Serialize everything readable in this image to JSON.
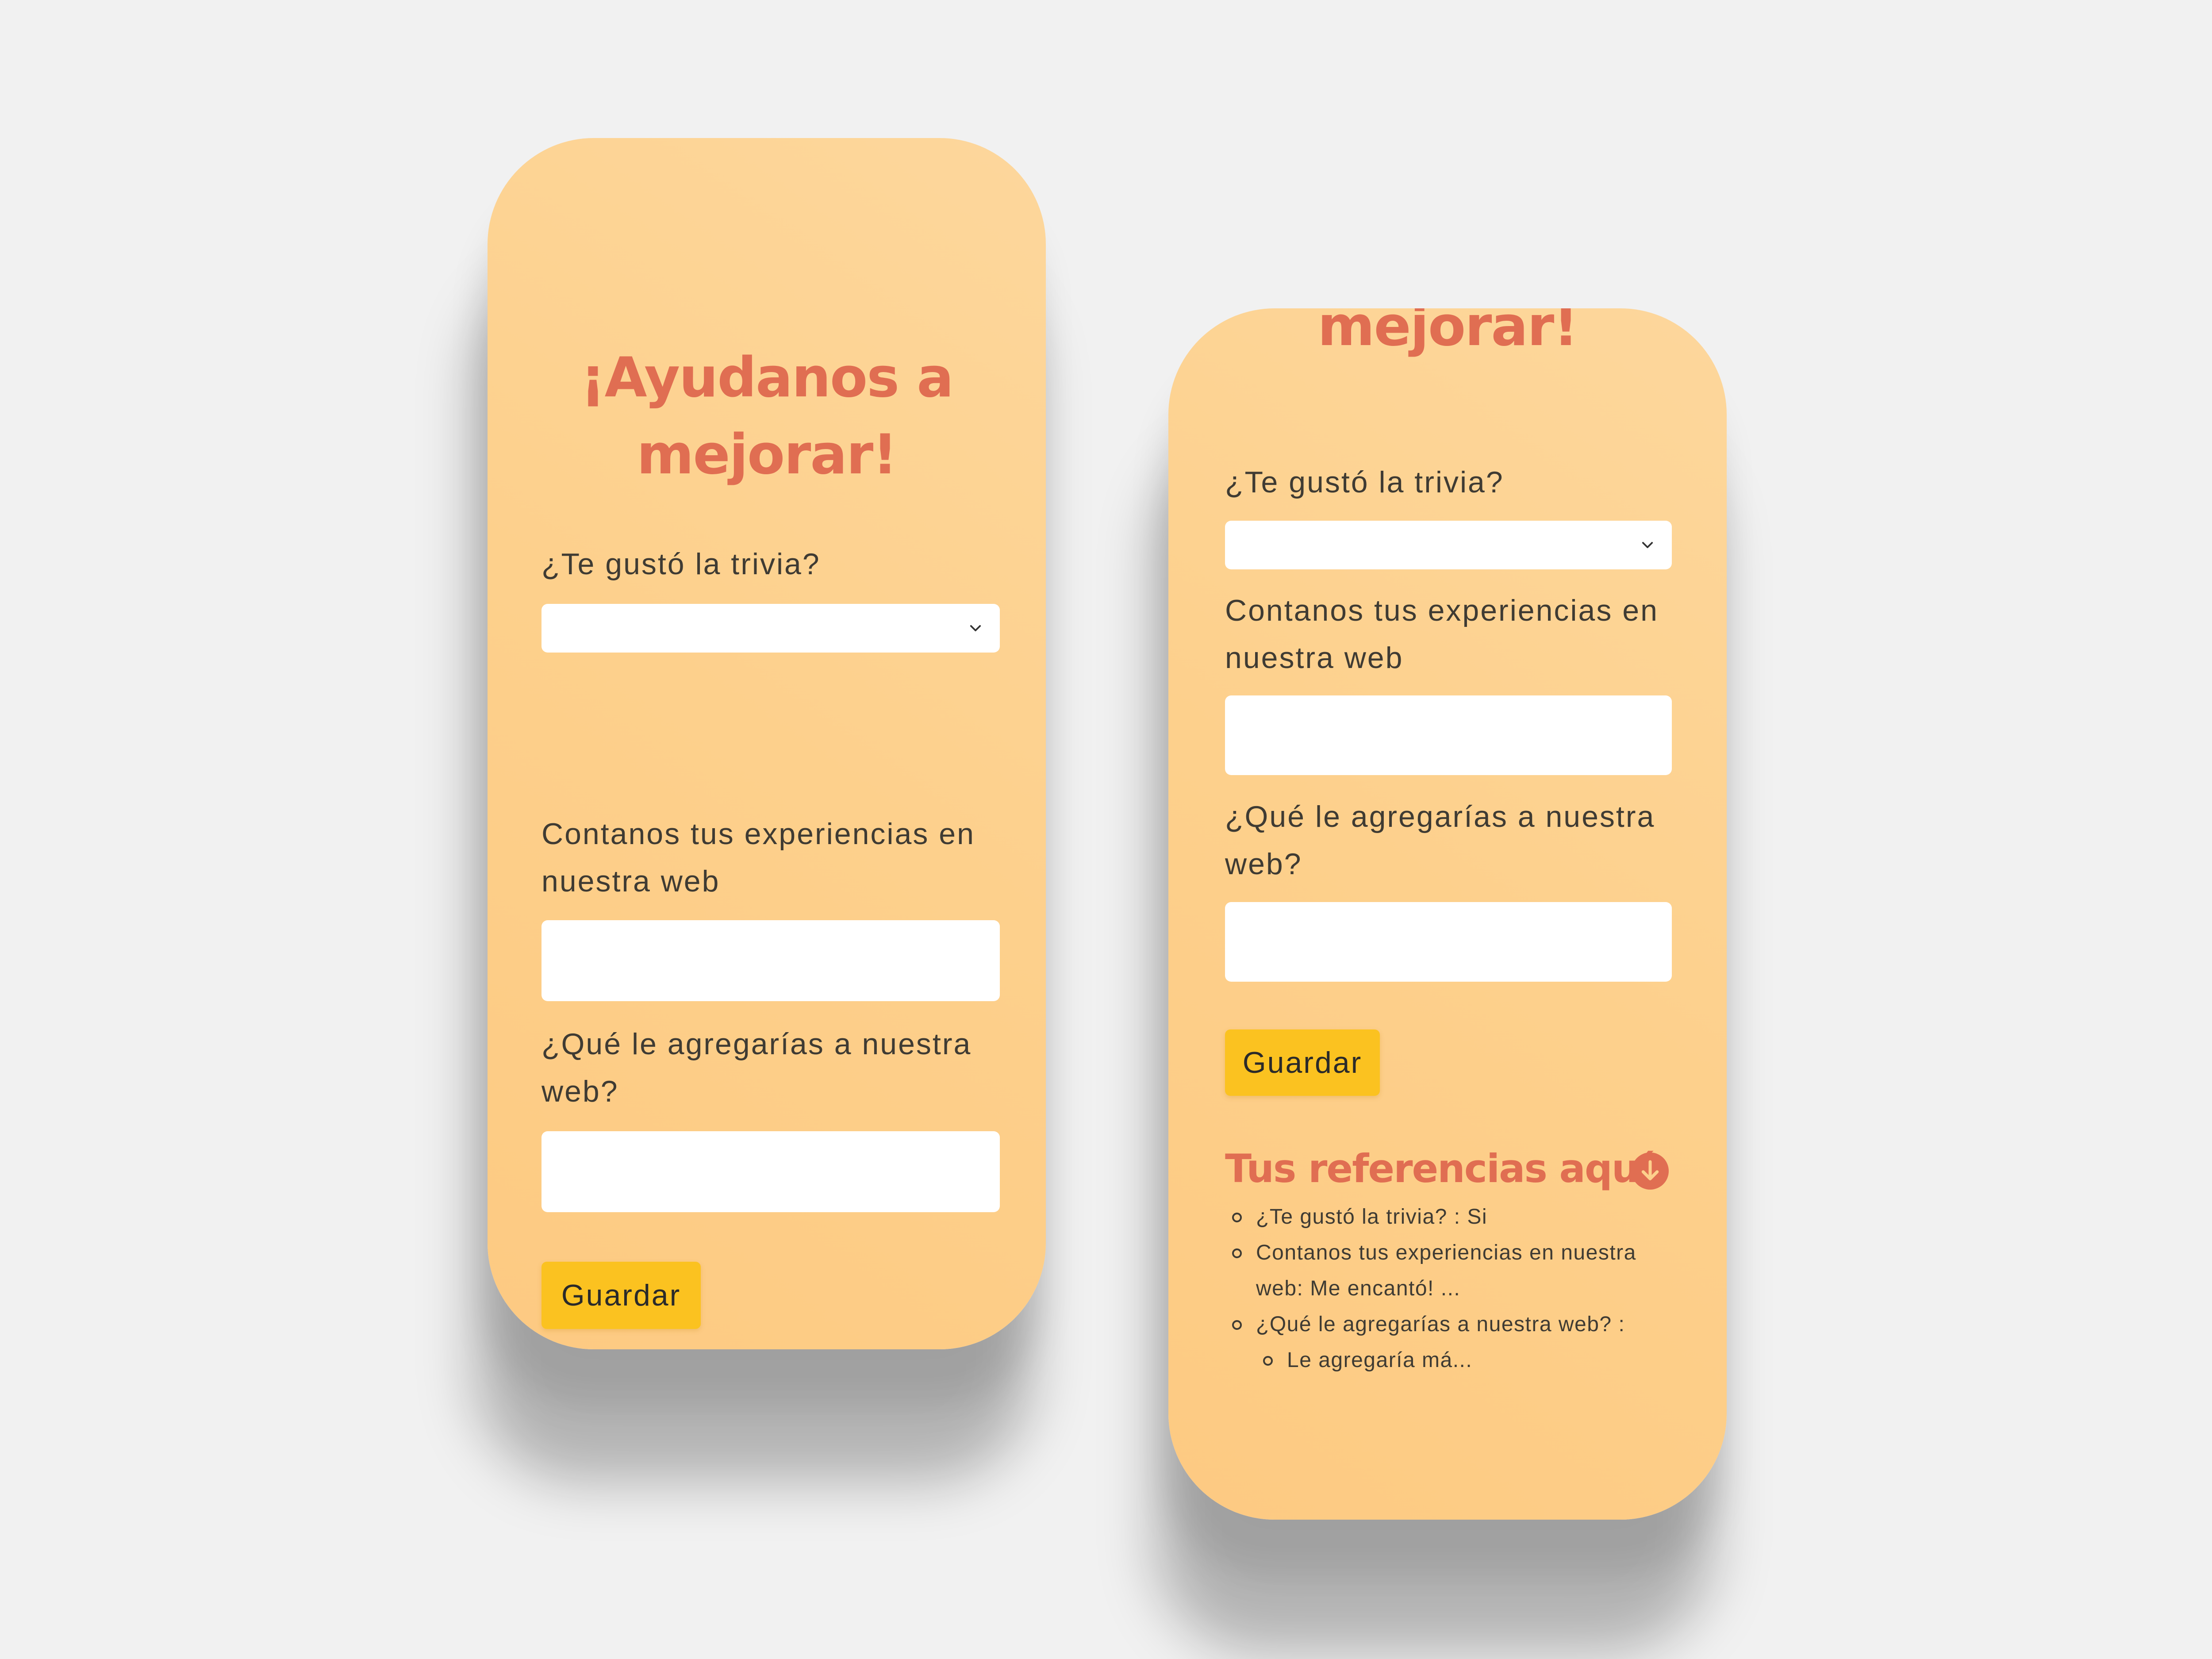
{
  "form": {
    "title": "¡Ayudanos a mejorar!",
    "title_line1": "¡Ayudanos a",
    "title_line2": "mejorar!",
    "q1_label": "¿Te gustó la trivia?",
    "q1_value": "",
    "q2_label_line1": "Contanos tus experiencias en",
    "q2_label_line2": "nuestra web",
    "q2_value": "",
    "q3_label_line1": "¿Qué le agregarías a nuestra",
    "q3_label_line2": "web?",
    "q3_value": "",
    "save_label": "Guardar"
  },
  "references": {
    "title": "Tus referencias aquí",
    "items": [
      {
        "text": "¿Te gustó la trivia? : Si"
      },
      {
        "text_line1": "Contanos tus experiencias en nuestra",
        "text_line2": "web: Me encantó! ..."
      },
      {
        "text": "¿Qué le agregarías a nuestra web? :",
        "sub": "Le agregaría má..."
      }
    ]
  },
  "icons": {
    "dropdown": "chevron-down-icon",
    "references": "arrow-down-circle-icon"
  },
  "colors": {
    "background": "#f1f1f1",
    "card": "#fdcf8a",
    "heading": "#e06e52",
    "text": "#3f3b33",
    "button": "#fbc220",
    "input": "#ffffff"
  }
}
